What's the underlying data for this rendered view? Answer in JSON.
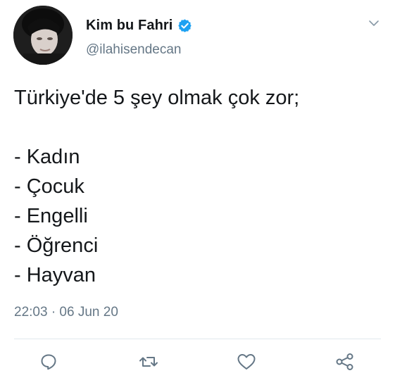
{
  "tweet": {
    "display_name": "Kim bu Fahri",
    "handle": "@ilahisendecan",
    "verified": true,
    "text_lines": [
      "Türkiye'de 5 şey olmak çok zor;",
      "",
      "- Kadın",
      "- Çocuk",
      "- Engelli",
      "- Öğrenci",
      "- Hayvan"
    ],
    "timestamp": "22:03 · 06 Jun 20"
  },
  "icons": {
    "verified": "verified-badge-icon",
    "menu": "chevron-down-icon",
    "reply": "reply-icon",
    "retweet": "retweet-icon",
    "like": "heart-icon",
    "share": "share-icon"
  },
  "colors": {
    "accent": "#1da1f2",
    "text_primary": "#14171a",
    "text_secondary": "#657786",
    "icon_gray": "#657786",
    "divider": "#e1e8ed"
  }
}
